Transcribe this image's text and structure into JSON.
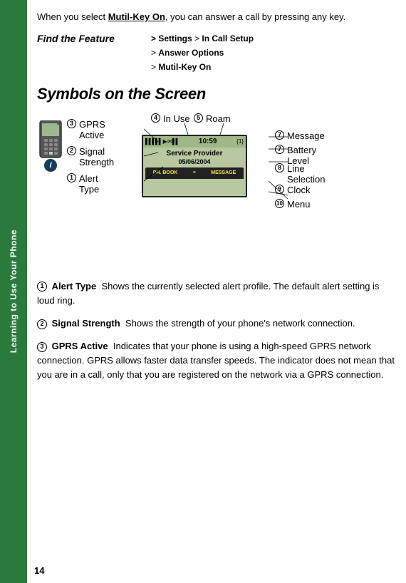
{
  "sidebar": {
    "label": "Learning to Use Your Phone",
    "bg_color": "#2a7a3b"
  },
  "intro": {
    "text1": "When you select ",
    "highlight": "Mutil-Key On",
    "text2": ", you can answer a call by pressing any key."
  },
  "find_feature": {
    "label": "Find the Feature",
    "path_lines": [
      "> Settings > In Call Setup",
      "> Answer Options",
      "> Mutil-Key On"
    ]
  },
  "section_title": "Symbols on the Screen",
  "screen": {
    "time": "10:59",
    "provider": "Service Provider",
    "date": "05/06/2004",
    "bottom_left": "PH. BOOK",
    "bottom_right": "MESSAGE"
  },
  "annotations": {
    "left": [
      {
        "num": "3",
        "label": "GPRS\nActive"
      },
      {
        "num": "2",
        "label": "Signal\nStrength"
      },
      {
        "num": "1",
        "label": "Alert\nType"
      }
    ],
    "top": [
      {
        "num": "4",
        "label": "In Use"
      },
      {
        "num": "5",
        "label": "Roam"
      }
    ],
    "right": [
      {
        "num": "7",
        "label": "Message"
      },
      {
        "num": "7",
        "label": "Battery\nLevel"
      },
      {
        "num": "8",
        "label": "Line\nSelection"
      },
      {
        "num": "9",
        "label": "Clock"
      },
      {
        "num": "10",
        "label": "Menu"
      }
    ]
  },
  "descriptions": [
    {
      "num": "1",
      "term": "Alert Type",
      "text": "Shows the currently selected alert profile. The default alert setting is loud ring."
    },
    {
      "num": "2",
      "term": "Signal Strength",
      "text": "Shows the strength of your phone's network connection."
    },
    {
      "num": "3",
      "term": "GPRS Active",
      "text": "Indicates that your phone is using a high-speed GPRS network connection. GPRS allows faster data transfer speeds. The indicator does not mean that you are in a call, only that you are registered on the network via a GPRS connection."
    }
  ],
  "page_number": "14"
}
